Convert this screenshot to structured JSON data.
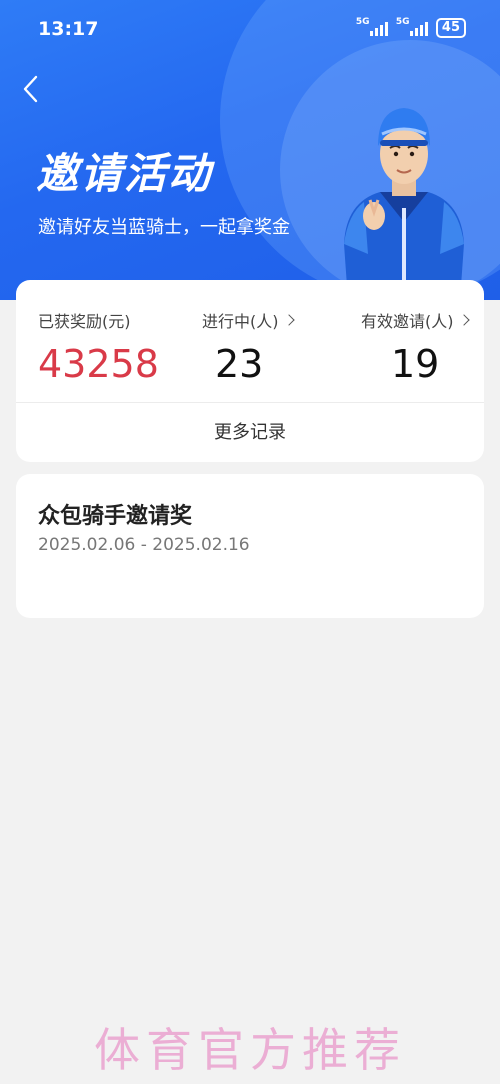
{
  "status_bar": {
    "time": "13:17",
    "sim1": "5G",
    "sim2": "5G",
    "battery": "45"
  },
  "header": {
    "back_icon": "chevron-left-icon",
    "title": "邀请活动",
    "subtitle": "邀请好友当蓝骑士，一起拿奖金"
  },
  "stats": {
    "reward_label": "已获奖励(元)",
    "reward_value": "43258",
    "ongoing_label": "进行中(人)",
    "ongoing_value": "23",
    "valid_label": "有效邀请(人)",
    "valid_value": "19",
    "more_records": "更多记录"
  },
  "promotion": {
    "title": "众包骑手邀请奖",
    "date_range": "2025.02.06 - 2025.02.16"
  },
  "watermark": "体育官方推荐",
  "colors": {
    "hero_blue": "#2468f0",
    "reward_red": "#d93a48",
    "background": "#f2f2f2"
  }
}
